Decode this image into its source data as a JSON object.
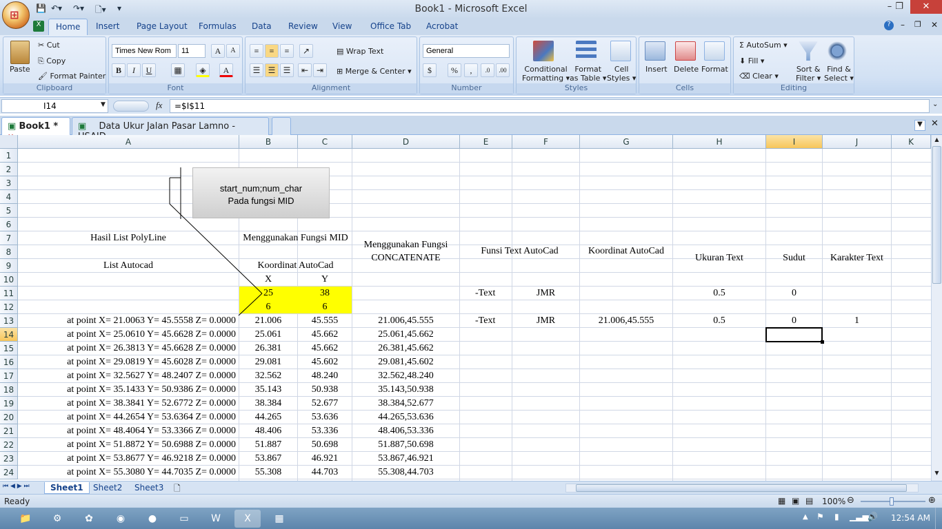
{
  "window": {
    "title": "Book1 - Microsoft Excel"
  },
  "ribbon_tabs": [
    "Home",
    "Insert",
    "Page Layout",
    "Formulas",
    "Data",
    "Review",
    "View",
    "Office Tab",
    "Acrobat"
  ],
  "clipboard": {
    "paste": "Paste",
    "cut": "Cut",
    "copy": "Copy",
    "format_painter": "Format Painter",
    "label": "Clipboard"
  },
  "font": {
    "name": "Times New Rom",
    "size": "11",
    "label": "Font"
  },
  "alignment": {
    "wrap": "Wrap Text",
    "merge": "Merge & Center",
    "label": "Alignment"
  },
  "number": {
    "format": "General",
    "label": "Number",
    "currency": "$",
    "percent": "%",
    "comma": ","
  },
  "styles": {
    "cond": "Conditional",
    "cond2": "Formatting",
    "fmt": "Format",
    "fmt2": "as Table",
    "cell": "Cell",
    "cell2": "Styles",
    "label": "Styles"
  },
  "cells": {
    "insert": "Insert",
    "delete": "Delete",
    "format": "Format",
    "label": "Cells"
  },
  "editing": {
    "autosum": "AutoSum",
    "fill": "Fill",
    "clear": "Clear",
    "sort": "Sort &",
    "sort2": "Filter",
    "find": "Find &",
    "find2": "Select",
    "label": "Editing"
  },
  "formula_bar": {
    "name_box": "I14",
    "fx": "fx",
    "formula": "=$I$11"
  },
  "doc_tabs": [
    "Book1 *",
    "Data Ukur Jalan Pasar Lamno - USAID"
  ],
  "columns": [
    "A",
    "B",
    "C",
    "D",
    "E",
    "F",
    "G",
    "H",
    "I",
    "J",
    "K"
  ],
  "rows": [
    "1",
    "2",
    "3",
    "4",
    "5",
    "6",
    "7",
    "8",
    "9",
    "10",
    "11",
    "12",
    "13",
    "14",
    "15",
    "16",
    "17",
    "18",
    "19",
    "20",
    "21",
    "22",
    "23",
    "24"
  ],
  "shape": {
    "line1": "start_num;num_char",
    "line2": "Pada fungsi MID"
  },
  "headers": {
    "a7": "Hasil List PolyLine",
    "a9": "List Autocad",
    "b7": "Menggunakan Fungsi MID",
    "b9": "Koordinat AutoCad",
    "b10": "X",
    "c10": "Y",
    "d1": "Menggunakan Fungsi",
    "d2": "CONCATENATE",
    "e": "Funsi Text AutoCad",
    "g": "Koordinat AutoCad",
    "h": "Ukuran Text",
    "i": "Sudut",
    "j": "Karakter Text"
  },
  "mid_params": {
    "b11": "25",
    "c11": "38",
    "b12": "6",
    "c12": "6"
  },
  "row11": {
    "e": "-Text",
    "f": "JMR",
    "h": "0.5",
    "i": "0"
  },
  "row13": {
    "e": "-Text",
    "f": "JMR",
    "g": "21.006,45.555",
    "h": "0.5",
    "i": "0",
    "j": "1"
  },
  "data_rows": [
    {
      "a": "at point  X=  21.0063  Y=  45.5558  Z=   0.0000",
      "b": "21.006",
      "c": "45.555",
      "d": "21.006,45.555"
    },
    {
      "a": "at point  X=  25.0610  Y=  45.6628  Z=   0.0000",
      "b": "25.061",
      "c": "45.662",
      "d": "25.061,45.662"
    },
    {
      "a": "at point  X=  26.3813  Y=  45.6628  Z=   0.0000",
      "b": "26.381",
      "c": "45.662",
      "d": "26.381,45.662"
    },
    {
      "a": "at point  X=  29.0819  Y=  45.6028  Z=   0.0000",
      "b": "29.081",
      "c": "45.602",
      "d": "29.081,45.602"
    },
    {
      "a": "at point  X=  32.5627  Y=  48.2407  Z=   0.0000",
      "b": "32.562",
      "c": "48.240",
      "d": "32.562,48.240"
    },
    {
      "a": "at point  X=  35.1433  Y=  50.9386  Z=   0.0000",
      "b": "35.143",
      "c": "50.938",
      "d": "35.143,50.938"
    },
    {
      "a": "at point  X=  38.3841  Y=  52.6772  Z=   0.0000",
      "b": "38.384",
      "c": "52.677",
      "d": "38.384,52.677"
    },
    {
      "a": "at point  X=  44.2654  Y=  53.6364  Z=   0.0000",
      "b": "44.265",
      "c": "53.636",
      "d": "44.265,53.636"
    },
    {
      "a": "at point  X=  48.4064  Y=  53.3366  Z=   0.0000",
      "b": "48.406",
      "c": "53.336",
      "d": "48.406,53.336"
    },
    {
      "a": "at point  X=  51.8872  Y=  50.6988  Z=   0.0000",
      "b": "51.887",
      "c": "50.698",
      "d": "51.887,50.698"
    },
    {
      "a": "at point  X=  53.8677  Y=  46.9218  Z=   0.0000",
      "b": "53.867",
      "c": "46.921",
      "d": "53.867,46.921"
    },
    {
      "a": "at point  X=  55.3080  Y=  44.7035  Z=   0.0000",
      "b": "55.308",
      "c": "44.703",
      "d": "55.308,44.703"
    }
  ],
  "sheets": [
    "Sheet1",
    "Sheet2",
    "Sheet3"
  ],
  "status": {
    "ready": "Ready",
    "zoom": "100%"
  },
  "taskbar": {
    "clock": "12:54 AM"
  },
  "colors": {
    "accent": "#15428b",
    "highlight": "#ffff00",
    "selected_header": "#f7c65a"
  }
}
